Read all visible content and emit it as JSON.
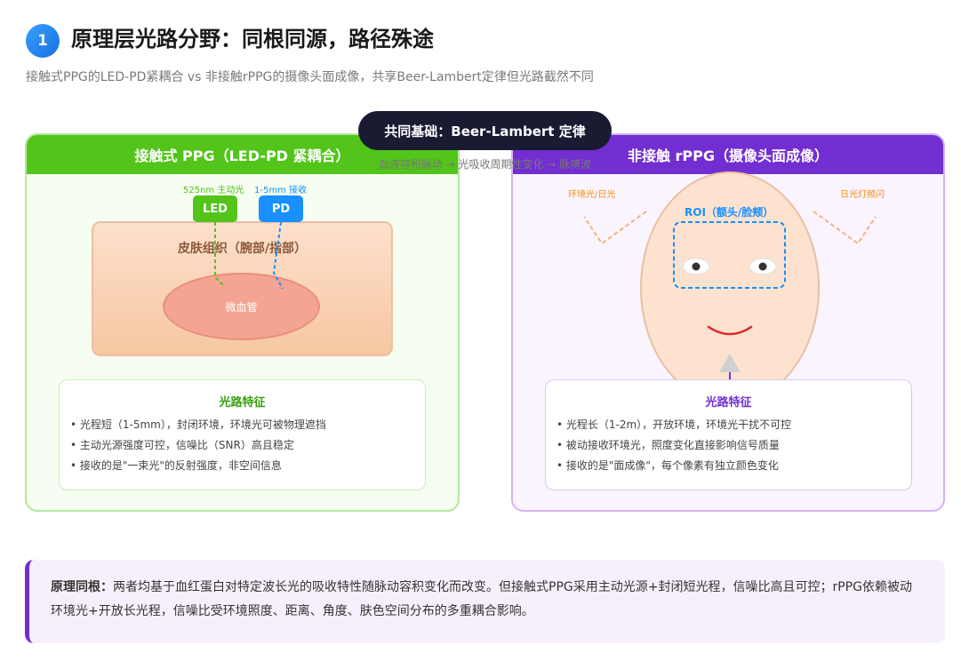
{
  "header": {
    "number": "1",
    "title": "原理层光路分野：同根同源，路径殊途",
    "subtitle": "接触式PPG的LED-PD紧耦合 vs 非接触rPPG的摄像头面成像，共享Beer-Lambert定律但光路截然不同"
  },
  "center": {
    "pill": "共同基础：Beer-Lambert 定律",
    "sub": "血液容积脉动 → 光吸收周期性变化 → 脉搏波"
  },
  "left_panel": {
    "title": "接触式 PPG（LED-PD 紧耦合）",
    "led_note": "525nm 主动光",
    "pd_note": "1-5mm 接收",
    "led": "LED",
    "pd": "PD",
    "skin": "皮肤组织（腕部/指部）",
    "vessel": "微血管",
    "feature_title": "光路特征",
    "features": [
      "• 光程短（1-5mm），封闭环境，环境光可被物理遮挡",
      "• 主动光源强度可控，信噪比（SNR）高且稳定",
      "• 接收的是\"一束光\"的反射强度，非空间信息"
    ]
  },
  "right_panel": {
    "title": "非接触 rPPG（摄像头面成像）",
    "ambient_left": "环境光/日光",
    "ambient_right": "日光灯频闪",
    "roi": "ROI（额头/脸颊）",
    "feature_title": "光路特征",
    "features": [
      "• 光程长（1-2m），开放环境，环境光干扰不可控",
      "• 被动接收环境光，照度变化直接影响信号质量",
      "• 接收的是\"面成像\"，每个像素有独立颜色变化"
    ]
  },
  "note": {
    "label": "原理同根：",
    "text": "两者均基于血红蛋白对特定波长光的吸收特性随脉动容积变化而改变。但接触式PPG采用主动光源+封闭短光程，信噪比高且可控；rPPG依赖被动环境光+开放长光程，信噪比受环境照度、距离、角度、肤色空间分布的多重耦合影响。"
  },
  "colors": {
    "green": "#52c41a",
    "purple": "#722ed1",
    "blue": "#1890ff",
    "dark": "#1a1b33",
    "orange": "#fa8c16"
  }
}
